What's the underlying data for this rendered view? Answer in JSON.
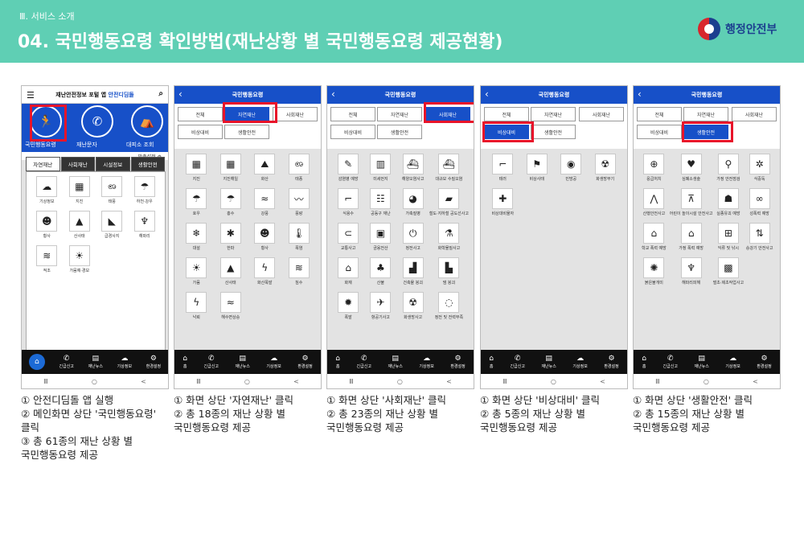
{
  "header": {
    "section": "Ⅲ. 서비스 소개",
    "title": "04. 국민행동요령 확인방법(재난상황 별 국민행동요령 제공현황)",
    "logo_text": "행정안전부",
    "bg_color": "#5fcfb4"
  },
  "common": {
    "screen_title": "국민행동요령",
    "tab_all": "전체",
    "tab_natural": "자연재난",
    "tab_social": "사회재난",
    "tab_emergency": "비상대비",
    "tab_life": "생활안전",
    "bottom_nav": [
      {
        "icon": "house-icon",
        "label": "홈"
      },
      {
        "icon": "phone-icon",
        "label": "긴급신고"
      },
      {
        "icon": "news-icon",
        "label": "재난뉴스"
      },
      {
        "icon": "weather-icon",
        "label": "기상정보"
      },
      {
        "icon": "gear-icon",
        "label": "환경설정"
      }
    ],
    "sys_keys": [
      "Ⅲ",
      "○",
      "<"
    ]
  },
  "screen1": {
    "title_plain": "재난안전정보 포털 앱",
    "title_accent": "안전디딤돌",
    "menu": [
      {
        "icon": "person-run-icon",
        "label": "국민행동요령"
      },
      {
        "icon": "phone-icon",
        "label": "재난문자"
      },
      {
        "icon": "shelter-icon",
        "label": "대피소 조회"
      }
    ],
    "settings_label": "맞춤설정",
    "cat_tabs": [
      "자연재난",
      "사회재난",
      "시설정보",
      "생활안전"
    ],
    "items": [
      {
        "icon": "cloud-icon",
        "label": "기상정보"
      },
      {
        "icon": "building-icon",
        "label": "지진"
      },
      {
        "icon": "typhoon-icon",
        "label": "태풍"
      },
      {
        "icon": "rain-icon",
        "label": "하천·강우"
      },
      {
        "icon": "mask-icon",
        "label": "황사"
      },
      {
        "icon": "mountain-icon",
        "label": "산사태"
      },
      {
        "icon": "slope-icon",
        "label": "급경사지"
      },
      {
        "icon": "jellyfish-icon",
        "label": "해파리"
      },
      {
        "icon": "tide-icon",
        "label": "적조"
      },
      {
        "icon": "drought-icon",
        "label": "가뭄예·경보"
      }
    ]
  },
  "screen2": {
    "items": [
      {
        "icon": "building-icon",
        "label": "지진"
      },
      {
        "icon": "building-icon",
        "label": "지진해일"
      },
      {
        "icon": "volcano-icon",
        "label": "화산"
      },
      {
        "icon": "typhoon-icon",
        "label": "태풍"
      },
      {
        "icon": "rain-icon",
        "label": "호우"
      },
      {
        "icon": "rain-icon",
        "label": "홍수"
      },
      {
        "icon": "wind-icon",
        "label": "강풍"
      },
      {
        "icon": "wave-icon",
        "label": "풍랑"
      },
      {
        "icon": "snow-icon",
        "label": "대설"
      },
      {
        "icon": "cold-icon",
        "label": "한파"
      },
      {
        "icon": "mask-icon",
        "label": "황사"
      },
      {
        "icon": "thermometer-icon",
        "label": "폭염"
      },
      {
        "icon": "sun-icon",
        "label": "가뭄"
      },
      {
        "icon": "mountain-icon",
        "label": "산사태"
      },
      {
        "icon": "lightning-icon",
        "label": "화산폭발"
      },
      {
        "icon": "flood-icon",
        "label": "침수"
      },
      {
        "icon": "lightning-icon",
        "label": "낙뢰"
      },
      {
        "icon": "sea-icon",
        "label": "해수면상승"
      }
    ]
  },
  "screen3": {
    "items": [
      {
        "icon": "syringe-icon",
        "label": "감염병 예방"
      },
      {
        "icon": "factory-icon",
        "label": "미세먼지"
      },
      {
        "icon": "ship-icon",
        "label": "해양오염사고"
      },
      {
        "icon": "ship-icon",
        "label": "대규모 수질오염"
      },
      {
        "icon": "water-icon",
        "label": "식용수"
      },
      {
        "icon": "people-icon",
        "label": "공동구 재난"
      },
      {
        "icon": "pig-icon",
        "label": "가축질병"
      },
      {
        "icon": "train-icon",
        "label": "철도·지하철 공도선사고"
      },
      {
        "icon": "car-icon",
        "label": "교통사고"
      },
      {
        "icon": "money-icon",
        "label": "금융전산"
      },
      {
        "icon": "power-icon",
        "label": "정전사고"
      },
      {
        "icon": "chemical-icon",
        "label": "화학물질사고"
      },
      {
        "icon": "fire-house-icon",
        "label": "화재"
      },
      {
        "icon": "forest-icon",
        "label": "산불"
      },
      {
        "icon": "collapse-icon",
        "label": "건축물 붕괴"
      },
      {
        "icon": "dam-icon",
        "label": "댐 붕괴"
      },
      {
        "icon": "explosion-icon",
        "label": "폭발"
      },
      {
        "icon": "airplane-icon",
        "label": "항공기사고"
      },
      {
        "icon": "radiation-icon",
        "label": "화생방사고"
      },
      {
        "icon": "gas-icon",
        "label": "정전 및 전력부족"
      }
    ]
  },
  "screen4": {
    "items": [
      {
        "icon": "gun-icon",
        "label": "테러"
      },
      {
        "icon": "siren-icon",
        "label": "비상사태"
      },
      {
        "icon": "alarm-icon",
        "label": "민방공"
      },
      {
        "icon": "radiation-icon",
        "label": "화생방무기"
      },
      {
        "icon": "kit-icon",
        "label": "비상대비물자"
      }
    ]
  },
  "screen5": {
    "items": [
      {
        "icon": "cpr-icon",
        "label": "응급처치"
      },
      {
        "icon": "aed-icon",
        "label": "심폐소생술"
      },
      {
        "icon": "home-safety-icon",
        "label": "가정 안전점검"
      },
      {
        "icon": "germ-icon",
        "label": "식중독"
      },
      {
        "icon": "hiking-icon",
        "label": "산행안전사고"
      },
      {
        "icon": "playground-icon",
        "label": "어린이 놀이시설 안전사고"
      },
      {
        "icon": "heat-icon",
        "label": "실종유괴 예방"
      },
      {
        "icon": "chain-icon",
        "label": "성폭력 예방"
      },
      {
        "icon": "school-icon",
        "label": "학교 폭력 예방"
      },
      {
        "icon": "house-violence-icon",
        "label": "가정 폭력 예방"
      },
      {
        "icon": "drown-icon",
        "label": "익류 및 낚시"
      },
      {
        "icon": "elevator-icon",
        "label": "승강기 안전사고"
      },
      {
        "icon": "bug-icon",
        "label": "붉은불개미"
      },
      {
        "icon": "jellyfish-icon",
        "label": "해파리피해"
      },
      {
        "icon": "tick-icon",
        "label": "벌초·제초작업사고"
      }
    ]
  },
  "captions": [
    [
      "① 안전디딤돌 앱 실행",
      "② 메인화면 상단 '국민행동요령'",
      "    클릭",
      "③ 총 61종의 재난 상황 별",
      "    국민행동요령 제공"
    ],
    [
      "① 화면 상단 '자연재난' 클릭",
      "② 총 18종의 재난 상황 별",
      "    국민행동요령 제공"
    ],
    [
      "① 화면 상단 '사회재난' 클릭",
      "② 총 23종의 재난 상황 별",
      "    국민행동요령 제공"
    ],
    [
      "① 화면 상단 '비상대비' 클릭",
      "② 총 5종의 재난 상황 별",
      "    국민행동요령 제공"
    ],
    [
      "① 화면 상단 '생활안전' 클릭",
      "② 총 15종의 재난 상황 별",
      "    국민행동요령 제공"
    ]
  ],
  "highlight_color": "#e8142a",
  "accent_color": "#1750c8"
}
